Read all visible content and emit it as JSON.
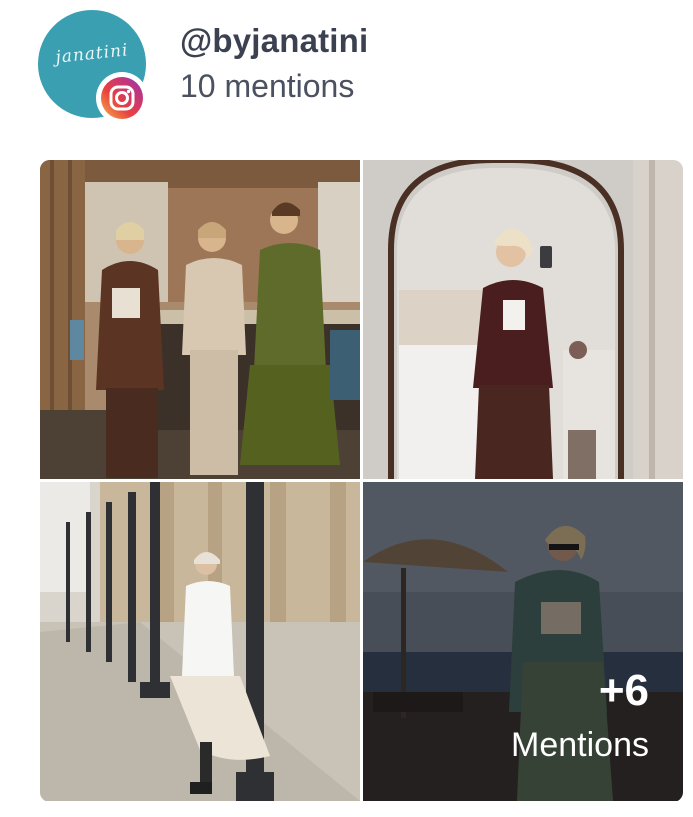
{
  "profile": {
    "logo_text": "janatini",
    "handle": "@byjanatini",
    "mentions": "10 mentions",
    "platform_icon": "instagram-icon",
    "avatar_color": "#3a9fb0"
  },
  "gallery": {
    "photos": [
      {
        "name": "photo-three-women-kitchen"
      },
      {
        "name": "photo-mirror-selfie"
      },
      {
        "name": "photo-street-lampposts"
      },
      {
        "name": "photo-beach-umbrella"
      }
    ],
    "more": {
      "count": "+6",
      "label": "Mentions"
    }
  }
}
